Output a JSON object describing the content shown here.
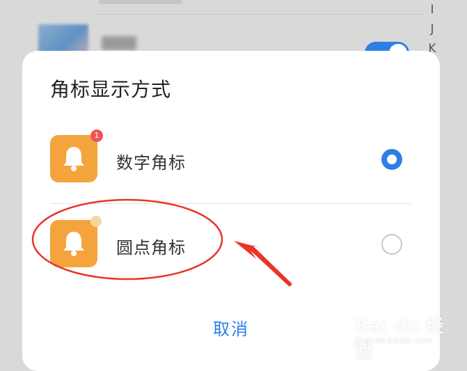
{
  "background": {
    "index_letters": [
      "I",
      "J",
      "K"
    ]
  },
  "sheet": {
    "title": "角标显示方式",
    "options": [
      {
        "label": "数字角标",
        "badge_text": "1",
        "selected": true,
        "icon": "bell-icon"
      },
      {
        "label": "圆点角标",
        "selected": false,
        "icon": "bell-icon"
      }
    ],
    "cancel_label": "取消"
  },
  "watermark": {
    "text": "Bai du 经验",
    "sub": "jingyan.baidu.com"
  },
  "colors": {
    "accent": "#2f7ee6",
    "icon_bg": "#f4a43c",
    "badge": "#f05454",
    "annotation": "#e8342a"
  }
}
